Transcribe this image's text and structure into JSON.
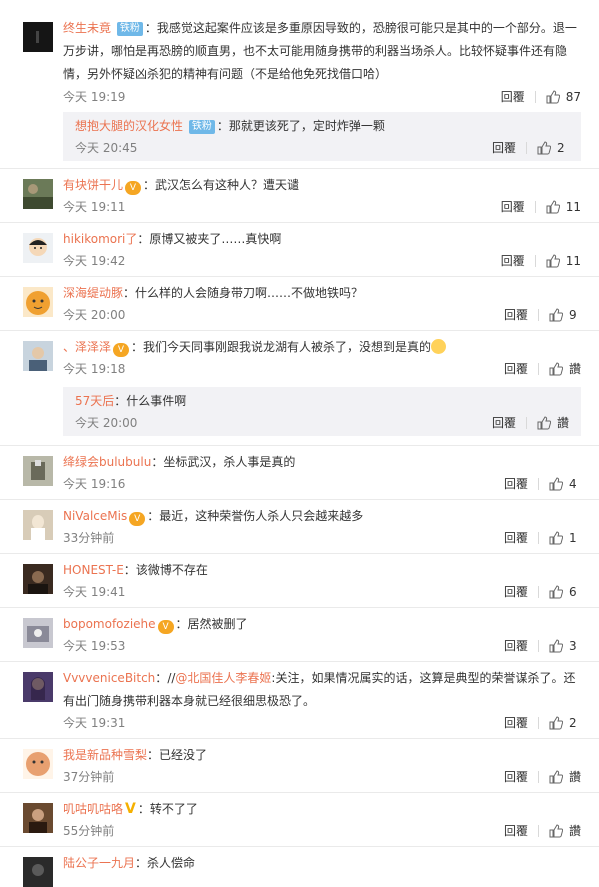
{
  "reply_label": "回覆",
  "comments": [
    {
      "username": "终生未竟",
      "badge": "铁粉",
      "text": "我感觉这起案件应该是多重原因导致的，恐膀很可能只是其中的一个部分。退一万步讲，哪怕是再恐膀的顺直男，也不太可能用随身携带的利器当场杀人。比较怀疑事件还有隐情，另外怀疑凶杀犯的精神有问题（不是给他免死找借口哈）",
      "time": "今天 19:19",
      "likes": "87",
      "avatar_color": "#1a1a1a",
      "sub": {
        "username": "想抱大腿的汉化女性",
        "badge": "铁粉",
        "text": "那就更该死了，定时炸弹一颗",
        "time": "今天 20:45",
        "likes": "2"
      }
    },
    {
      "username": "有块饼干儿",
      "text": "武汉怎么有这种人？遭天谴",
      "time": "今天 19:11",
      "likes": "11",
      "avatar_color": "#5a6a4a"
    },
    {
      "username": "hikikomori了",
      "text": "原博又被夹了……真快啊",
      "time": "今天 19:42",
      "likes": "11",
      "avatar_color": "#e8ecf0"
    },
    {
      "username": "深海缇动豚",
      "text": "什么样的人会随身带刀啊……不做地铁吗？",
      "time": "今天 20:00",
      "likes": "9",
      "avatar_color": "#f0a030"
    },
    {
      "username": "、泽泽泽",
      "text": "我们今天同事刚跟我说龙湖有人被杀了，没想到是真的",
      "time": "今天 19:18",
      "likes": "讚",
      "avatar_color": "#7a8ea0",
      "sub": {
        "username": "57天后",
        "text": "什么事件啊",
        "time": "今天 20:00",
        "likes": "讚"
      }
    },
    {
      "username": "绛绿会bulubulu",
      "text": "坐标武汉，杀人事是真的",
      "time": "今天 19:16",
      "likes": "4",
      "avatar_color": "#9a9a88"
    },
    {
      "username": "NiValceMis",
      "text": "最近，这种荣誉伤人杀人只会越来越多",
      "time": "33分钟前",
      "likes": "1",
      "avatar_color": "#c8b8a0"
    },
    {
      "username": "HONEST-E",
      "text": "该微博不存在",
      "time": "今天 19:41",
      "likes": "6",
      "avatar_color": "#3a2a20"
    },
    {
      "username": "bopomofoziehe",
      "text": "居然被删了",
      "time": "今天 19:53",
      "likes": "3",
      "avatar_color": "#b0b0b8"
    },
    {
      "username": "VvvveniceBitch",
      "text_prefix": "//",
      "mention": "@北国佳人李春姬",
      "text": ":关注，如果情况属实的话，这算是典型的荣誉谋杀了。还有出门随身携带利器本身就已经很细思极恐了。",
      "time": "今天 19:31",
      "likes": "2",
      "avatar_color": "#6a5a8a"
    },
    {
      "username": "我是新品种雪梨",
      "text": "已经没了",
      "time": "37分钟前",
      "likes": "讚",
      "avatar_color": "#e8a070"
    },
    {
      "username": "叽咕叽咕咯",
      "text": "转不了了",
      "time": "55分钟前",
      "likes": "讚",
      "avatar_color": "#6a4a30"
    },
    {
      "username": "陆公子一九月",
      "text": "杀人偿命",
      "time": "",
      "likes": "",
      "avatar_color": "#2a2a2a"
    }
  ]
}
